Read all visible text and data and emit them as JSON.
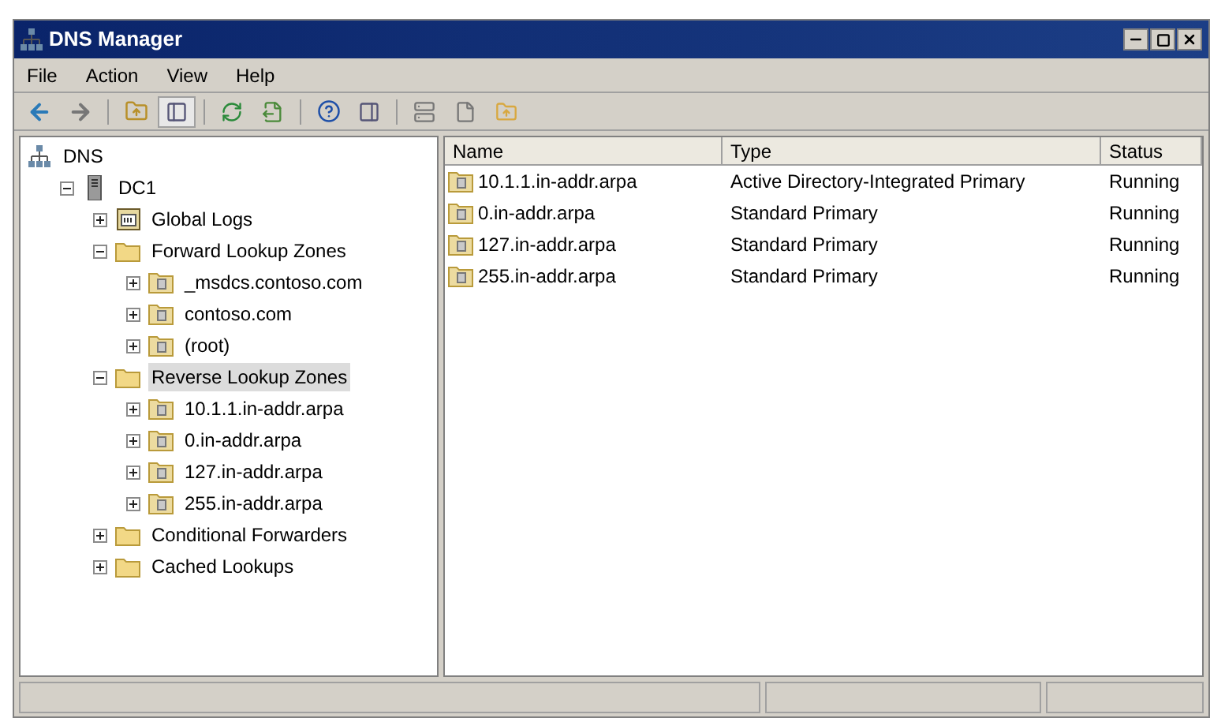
{
  "window": {
    "title": "DNS Manager"
  },
  "menu": [
    {
      "label": "File"
    },
    {
      "label": "Action"
    },
    {
      "label": "View"
    },
    {
      "label": "Help"
    }
  ],
  "tree": [
    {
      "label": "DNS",
      "kind": "dns",
      "selected": false,
      "children": [
        {
          "label": "DC1",
          "kind": "server",
          "expanded": true,
          "selected": false,
          "children": [
            {
              "label": "Global Logs",
              "kind": "log",
              "expanded": false,
              "selected": false
            },
            {
              "label": "Forward Lookup Zones",
              "kind": "folder",
              "expanded": true,
              "selected": false,
              "children": [
                {
                  "label": "_msdcs.contoso.com",
                  "kind": "zone",
                  "expanded": false,
                  "selected": false
                },
                {
                  "label": "contoso.com",
                  "kind": "zone",
                  "expanded": false,
                  "selected": false
                },
                {
                  "label": "(root)",
                  "kind": "zone",
                  "expanded": false,
                  "selected": false
                }
              ]
            },
            {
              "label": "Reverse Lookup Zones",
              "kind": "folder",
              "expanded": true,
              "selected": true,
              "children": [
                {
                  "label": "10.1.1.in-addr.arpa",
                  "kind": "zone",
                  "expanded": false,
                  "selected": false
                },
                {
                  "label": "0.in-addr.arpa",
                  "kind": "zone",
                  "expanded": false,
                  "selected": false
                },
                {
                  "label": "127.in-addr.arpa",
                  "kind": "zone",
                  "expanded": false,
                  "selected": false
                },
                {
                  "label": "255.in-addr.arpa",
                  "kind": "zone",
                  "expanded": false,
                  "selected": false
                }
              ]
            },
            {
              "label": "Conditional Forwarders",
              "kind": "folder",
              "expanded": false,
              "selected": false
            },
            {
              "label": "Cached Lookups",
              "kind": "folder",
              "expanded": false,
              "selected": false
            }
          ]
        }
      ]
    }
  ],
  "table": {
    "columns": [
      "Name",
      "Type",
      "Status"
    ],
    "rows": [
      {
        "name": "10.1.1.in-addr.arpa",
        "type": "Active Directory-Integrated Primary",
        "status": "Running"
      },
      {
        "name": "0.in-addr.arpa",
        "type": "Standard Primary",
        "status": "Running"
      },
      {
        "name": "127.in-addr.arpa",
        "type": "Standard Primary",
        "status": "Running"
      },
      {
        "name": "255.in-addr.arpa",
        "type": "Standard Primary",
        "status": "Running"
      }
    ]
  }
}
